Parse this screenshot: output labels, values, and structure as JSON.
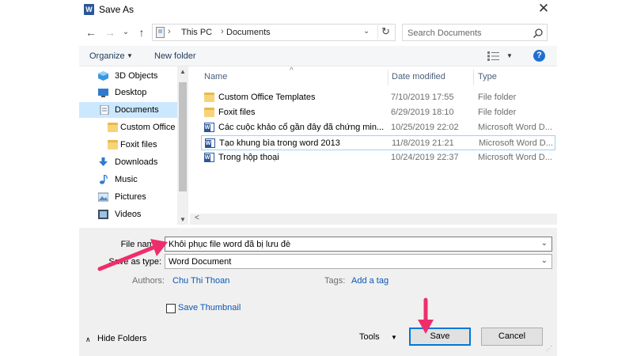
{
  "window": {
    "app_icon": "word-icon",
    "title": "Save As",
    "close_glyph": "✕"
  },
  "address": {
    "back_glyph": "←",
    "forward_glyph": "→",
    "recent_glyph": "⌄",
    "up_glyph": "↑",
    "crumbs": [
      "This PC",
      "Documents"
    ],
    "separator": "›",
    "dropdown_glyph": "⌄",
    "refresh_glyph": "↻"
  },
  "search": {
    "placeholder": "Search Documents"
  },
  "commands": {
    "organize": "Organize",
    "new_folder": "New folder",
    "caret": "▼",
    "help": "?"
  },
  "nav": {
    "items": [
      {
        "label": "3D Objects",
        "icon": "3d-objects-icon",
        "indent": false,
        "selected": false
      },
      {
        "label": "Desktop",
        "icon": "desktop-icon",
        "indent": false,
        "selected": false
      },
      {
        "label": "Documents",
        "icon": "documents-icon",
        "indent": false,
        "selected": true
      },
      {
        "label": "Custom Office",
        "icon": "folder-icon",
        "indent": true,
        "selected": false
      },
      {
        "label": "Foxit files",
        "icon": "folder-icon",
        "indent": true,
        "selected": false
      },
      {
        "label": "Downloads",
        "icon": "downloads-icon",
        "indent": false,
        "selected": false
      },
      {
        "label": "Music",
        "icon": "music-icon",
        "indent": false,
        "selected": false
      },
      {
        "label": "Pictures",
        "icon": "pictures-icon",
        "indent": false,
        "selected": false
      },
      {
        "label": "Videos",
        "icon": "videos-icon",
        "indent": false,
        "selected": false
      }
    ],
    "scroll_up": "▲",
    "scroll_down": "▼"
  },
  "files": {
    "columns": {
      "name": "Name",
      "date": "Date modified",
      "type": "Type",
      "sort_glyph": "^"
    },
    "rows": [
      {
        "name": "Custom Office Templates",
        "date": "7/10/2019 17:55",
        "type": "File folder",
        "kind": "folder"
      },
      {
        "name": "Foxit files",
        "date": "6/29/2019 18:10",
        "type": "File folder",
        "kind": "folder"
      },
      {
        "name": "Các cuộc khảo cổ gần đây đã chứng min...",
        "date": "10/25/2019 22:02",
        "type": "Microsoft Word D...",
        "kind": "doc"
      },
      {
        "name": "Tạo khung bìa trong word 2013",
        "date": "11/8/2019 21:21",
        "type": "Microsoft Word D...",
        "kind": "doc"
      },
      {
        "name": "Trong hộp thoại",
        "date": "10/24/2019 22:37",
        "type": "Microsoft Word D...",
        "kind": "doc"
      }
    ],
    "hscroll_left": "<"
  },
  "form": {
    "file_name_label": "File name:",
    "file_name_value": "Khôi phục file word đã bị lưu đè",
    "save_as_type_label": "Save as type:",
    "save_as_type_value": "Word Document",
    "dropdown_caret": "⌄",
    "authors_label": "Authors:",
    "authors_value": "Chu Thi Thoan",
    "tags_label": "Tags:",
    "tags_value": "Add a tag",
    "save_thumbnail": "Save Thumbnail"
  },
  "footer": {
    "hide_folders": "Hide Folders",
    "hide_caret": "∧",
    "tools": "Tools",
    "tools_caret": "▼",
    "save": "Save",
    "cancel": "Cancel",
    "grip": "⋰"
  },
  "colors": {
    "accent": "#0078d7",
    "selection": "#cce8ff",
    "link": "#0a57b4",
    "annotation_arrow": "#ee2e6b"
  }
}
